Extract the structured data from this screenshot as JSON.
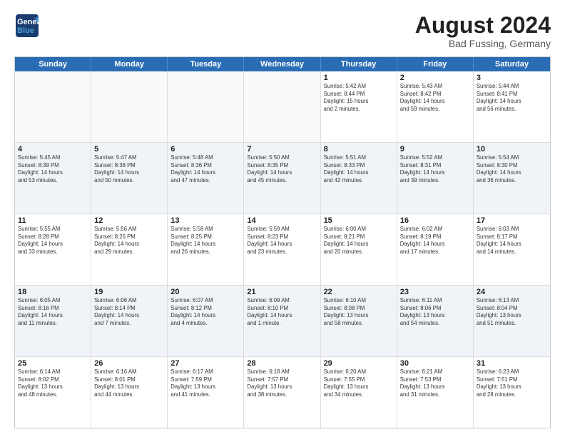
{
  "header": {
    "logo_line1": "General",
    "logo_line2": "Blue",
    "title": "August 2024",
    "subtitle": "Bad Fussing, Germany"
  },
  "weekdays": [
    "Sunday",
    "Monday",
    "Tuesday",
    "Wednesday",
    "Thursday",
    "Friday",
    "Saturday"
  ],
  "rows": [
    [
      {
        "day": "",
        "info": "",
        "empty": true
      },
      {
        "day": "",
        "info": "",
        "empty": true
      },
      {
        "day": "",
        "info": "",
        "empty": true
      },
      {
        "day": "",
        "info": "",
        "empty": true
      },
      {
        "day": "1",
        "info": "Sunrise: 5:42 AM\nSunset: 8:44 PM\nDaylight: 15 hours\nand 2 minutes."
      },
      {
        "day": "2",
        "info": "Sunrise: 5:43 AM\nSunset: 8:42 PM\nDaylight: 14 hours\nand 59 minutes."
      },
      {
        "day": "3",
        "info": "Sunrise: 5:44 AM\nSunset: 8:41 PM\nDaylight: 14 hours\nand 56 minutes."
      }
    ],
    [
      {
        "day": "4",
        "info": "Sunrise: 5:45 AM\nSunset: 8:39 PM\nDaylight: 14 hours\nand 53 minutes."
      },
      {
        "day": "5",
        "info": "Sunrise: 5:47 AM\nSunset: 8:38 PM\nDaylight: 14 hours\nand 50 minutes."
      },
      {
        "day": "6",
        "info": "Sunrise: 5:48 AM\nSunset: 8:36 PM\nDaylight: 14 hours\nand 47 minutes."
      },
      {
        "day": "7",
        "info": "Sunrise: 5:50 AM\nSunset: 8:35 PM\nDaylight: 14 hours\nand 45 minutes."
      },
      {
        "day": "8",
        "info": "Sunrise: 5:51 AM\nSunset: 8:33 PM\nDaylight: 14 hours\nand 42 minutes."
      },
      {
        "day": "9",
        "info": "Sunrise: 5:52 AM\nSunset: 8:31 PM\nDaylight: 14 hours\nand 39 minutes."
      },
      {
        "day": "10",
        "info": "Sunrise: 5:54 AM\nSunset: 8:30 PM\nDaylight: 14 hours\nand 36 minutes."
      }
    ],
    [
      {
        "day": "11",
        "info": "Sunrise: 5:55 AM\nSunset: 8:28 PM\nDaylight: 14 hours\nand 33 minutes."
      },
      {
        "day": "12",
        "info": "Sunrise: 5:56 AM\nSunset: 8:26 PM\nDaylight: 14 hours\nand 29 minutes."
      },
      {
        "day": "13",
        "info": "Sunrise: 5:58 AM\nSunset: 8:25 PM\nDaylight: 14 hours\nand 26 minutes."
      },
      {
        "day": "14",
        "info": "Sunrise: 5:59 AM\nSunset: 8:23 PM\nDaylight: 14 hours\nand 23 minutes."
      },
      {
        "day": "15",
        "info": "Sunrise: 6:00 AM\nSunset: 8:21 PM\nDaylight: 14 hours\nand 20 minutes."
      },
      {
        "day": "16",
        "info": "Sunrise: 6:02 AM\nSunset: 8:19 PM\nDaylight: 14 hours\nand 17 minutes."
      },
      {
        "day": "17",
        "info": "Sunrise: 6:03 AM\nSunset: 8:17 PM\nDaylight: 14 hours\nand 14 minutes."
      }
    ],
    [
      {
        "day": "18",
        "info": "Sunrise: 6:05 AM\nSunset: 8:16 PM\nDaylight: 14 hours\nand 11 minutes."
      },
      {
        "day": "19",
        "info": "Sunrise: 6:06 AM\nSunset: 8:14 PM\nDaylight: 14 hours\nand 7 minutes."
      },
      {
        "day": "20",
        "info": "Sunrise: 6:07 AM\nSunset: 8:12 PM\nDaylight: 14 hours\nand 4 minutes."
      },
      {
        "day": "21",
        "info": "Sunrise: 6:09 AM\nSunset: 8:10 PM\nDaylight: 14 hours\nand 1 minute."
      },
      {
        "day": "22",
        "info": "Sunrise: 6:10 AM\nSunset: 8:08 PM\nDaylight: 13 hours\nand 58 minutes."
      },
      {
        "day": "23",
        "info": "Sunrise: 6:11 AM\nSunset: 8:06 PM\nDaylight: 13 hours\nand 54 minutes."
      },
      {
        "day": "24",
        "info": "Sunrise: 6:13 AM\nSunset: 8:04 PM\nDaylight: 13 hours\nand 51 minutes."
      }
    ],
    [
      {
        "day": "25",
        "info": "Sunrise: 6:14 AM\nSunset: 8:02 PM\nDaylight: 13 hours\nand 48 minutes."
      },
      {
        "day": "26",
        "info": "Sunrise: 6:16 AM\nSunset: 8:01 PM\nDaylight: 13 hours\nand 44 minutes."
      },
      {
        "day": "27",
        "info": "Sunrise: 6:17 AM\nSunset: 7:59 PM\nDaylight: 13 hours\nand 41 minutes."
      },
      {
        "day": "28",
        "info": "Sunrise: 6:18 AM\nSunset: 7:57 PM\nDaylight: 13 hours\nand 38 minutes."
      },
      {
        "day": "29",
        "info": "Sunrise: 6:20 AM\nSunset: 7:55 PM\nDaylight: 13 hours\nand 34 minutes."
      },
      {
        "day": "30",
        "info": "Sunrise: 6:21 AM\nSunset: 7:53 PM\nDaylight: 13 hours\nand 31 minutes."
      },
      {
        "day": "31",
        "info": "Sunrise: 6:23 AM\nSunset: 7:51 PM\nDaylight: 13 hours\nand 28 minutes."
      }
    ]
  ]
}
